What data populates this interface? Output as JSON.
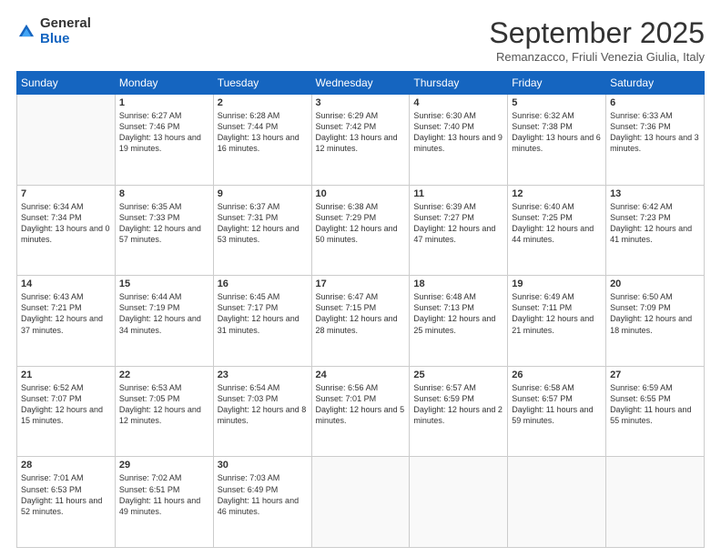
{
  "logo": {
    "general": "General",
    "blue": "Blue"
  },
  "header": {
    "title": "September 2025",
    "subtitle": "Remanzacco, Friuli Venezia Giulia, Italy"
  },
  "weekdays": [
    "Sunday",
    "Monday",
    "Tuesday",
    "Wednesday",
    "Thursday",
    "Friday",
    "Saturday"
  ],
  "weeks": [
    [
      {
        "day": null
      },
      {
        "day": "1",
        "sunrise": "6:27 AM",
        "sunset": "7:46 PM",
        "daylight": "13 hours and 19 minutes."
      },
      {
        "day": "2",
        "sunrise": "6:28 AM",
        "sunset": "7:44 PM",
        "daylight": "13 hours and 16 minutes."
      },
      {
        "day": "3",
        "sunrise": "6:29 AM",
        "sunset": "7:42 PM",
        "daylight": "13 hours and 12 minutes."
      },
      {
        "day": "4",
        "sunrise": "6:30 AM",
        "sunset": "7:40 PM",
        "daylight": "13 hours and 9 minutes."
      },
      {
        "day": "5",
        "sunrise": "6:32 AM",
        "sunset": "7:38 PM",
        "daylight": "13 hours and 6 minutes."
      },
      {
        "day": "6",
        "sunrise": "6:33 AM",
        "sunset": "7:36 PM",
        "daylight": "13 hours and 3 minutes."
      }
    ],
    [
      {
        "day": "7",
        "sunrise": "6:34 AM",
        "sunset": "7:34 PM",
        "daylight": "13 hours and 0 minutes."
      },
      {
        "day": "8",
        "sunrise": "6:35 AM",
        "sunset": "7:33 PM",
        "daylight": "12 hours and 57 minutes."
      },
      {
        "day": "9",
        "sunrise": "6:37 AM",
        "sunset": "7:31 PM",
        "daylight": "12 hours and 53 minutes."
      },
      {
        "day": "10",
        "sunrise": "6:38 AM",
        "sunset": "7:29 PM",
        "daylight": "12 hours and 50 minutes."
      },
      {
        "day": "11",
        "sunrise": "6:39 AM",
        "sunset": "7:27 PM",
        "daylight": "12 hours and 47 minutes."
      },
      {
        "day": "12",
        "sunrise": "6:40 AM",
        "sunset": "7:25 PM",
        "daylight": "12 hours and 44 minutes."
      },
      {
        "day": "13",
        "sunrise": "6:42 AM",
        "sunset": "7:23 PM",
        "daylight": "12 hours and 41 minutes."
      }
    ],
    [
      {
        "day": "14",
        "sunrise": "6:43 AM",
        "sunset": "7:21 PM",
        "daylight": "12 hours and 37 minutes."
      },
      {
        "day": "15",
        "sunrise": "6:44 AM",
        "sunset": "7:19 PM",
        "daylight": "12 hours and 34 minutes."
      },
      {
        "day": "16",
        "sunrise": "6:45 AM",
        "sunset": "7:17 PM",
        "daylight": "12 hours and 31 minutes."
      },
      {
        "day": "17",
        "sunrise": "6:47 AM",
        "sunset": "7:15 PM",
        "daylight": "12 hours and 28 minutes."
      },
      {
        "day": "18",
        "sunrise": "6:48 AM",
        "sunset": "7:13 PM",
        "daylight": "12 hours and 25 minutes."
      },
      {
        "day": "19",
        "sunrise": "6:49 AM",
        "sunset": "7:11 PM",
        "daylight": "12 hours and 21 minutes."
      },
      {
        "day": "20",
        "sunrise": "6:50 AM",
        "sunset": "7:09 PM",
        "daylight": "12 hours and 18 minutes."
      }
    ],
    [
      {
        "day": "21",
        "sunrise": "6:52 AM",
        "sunset": "7:07 PM",
        "daylight": "12 hours and 15 minutes."
      },
      {
        "day": "22",
        "sunrise": "6:53 AM",
        "sunset": "7:05 PM",
        "daylight": "12 hours and 12 minutes."
      },
      {
        "day": "23",
        "sunrise": "6:54 AM",
        "sunset": "7:03 PM",
        "daylight": "12 hours and 8 minutes."
      },
      {
        "day": "24",
        "sunrise": "6:56 AM",
        "sunset": "7:01 PM",
        "daylight": "12 hours and 5 minutes."
      },
      {
        "day": "25",
        "sunrise": "6:57 AM",
        "sunset": "6:59 PM",
        "daylight": "12 hours and 2 minutes."
      },
      {
        "day": "26",
        "sunrise": "6:58 AM",
        "sunset": "6:57 PM",
        "daylight": "11 hours and 59 minutes."
      },
      {
        "day": "27",
        "sunrise": "6:59 AM",
        "sunset": "6:55 PM",
        "daylight": "11 hours and 55 minutes."
      }
    ],
    [
      {
        "day": "28",
        "sunrise": "7:01 AM",
        "sunset": "6:53 PM",
        "daylight": "11 hours and 52 minutes."
      },
      {
        "day": "29",
        "sunrise": "7:02 AM",
        "sunset": "6:51 PM",
        "daylight": "11 hours and 49 minutes."
      },
      {
        "day": "30",
        "sunrise": "7:03 AM",
        "sunset": "6:49 PM",
        "daylight": "11 hours and 46 minutes."
      },
      {
        "day": null
      },
      {
        "day": null
      },
      {
        "day": null
      },
      {
        "day": null
      }
    ]
  ]
}
